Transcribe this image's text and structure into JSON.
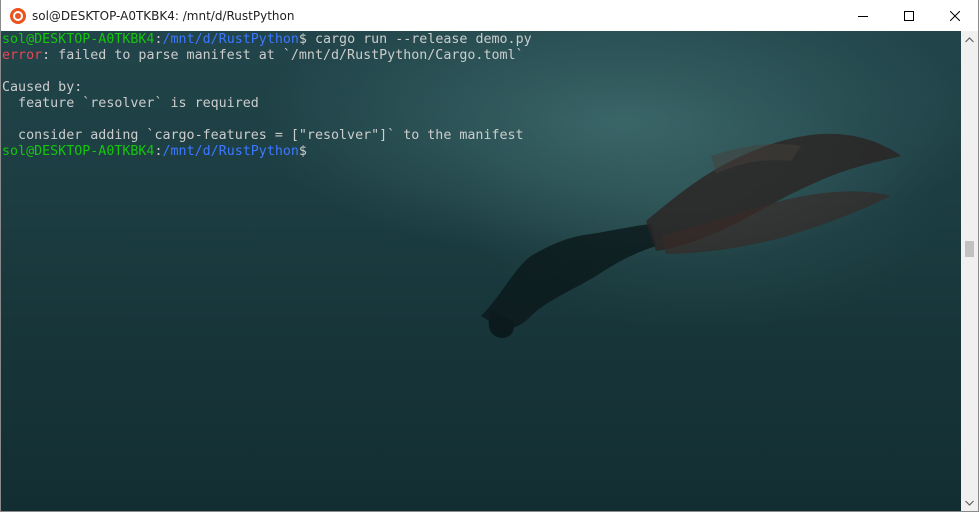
{
  "window": {
    "title": "sol@DESKTOP-A0TKBK4: /mnt/d/RustPython",
    "app_icon": "ubuntu-icon",
    "controls": [
      "minimize-icon",
      "maximize-icon",
      "close-icon"
    ]
  },
  "terminal": {
    "lines": [
      {
        "user": "sol@DESKTOP-A0TKBK4",
        "sep": ":",
        "path": "/mnt/d/RustPython",
        "dollar": "$",
        "command": " cargo run --release demo.py"
      },
      {
        "error_label": "error",
        "rest": ": failed to parse manifest at `/mnt/d/RustPython/Cargo.toml`"
      },
      {
        "text": ""
      },
      {
        "text": "Caused by:"
      },
      {
        "text": "  feature `resolver` is required"
      },
      {
        "text": ""
      },
      {
        "text": "  consider adding `cargo-features = [\"resolver\"]` to the manifest"
      },
      {
        "user": "sol@DESKTOP-A0TKBK4",
        "sep": ":",
        "path": "/mnt/d/RustPython",
        "dollar": "$",
        "command": ""
      }
    ]
  },
  "colors": {
    "prompt_user": "#16c60c",
    "prompt_path": "#3b78ff",
    "error": "#e74856",
    "text": "#cccccc",
    "ubuntu_orange": "#e95420"
  },
  "scrollbar": {
    "up_icon": "scroll-up-arrow-icon",
    "down_icon": "scroll-down-arrow-icon"
  }
}
